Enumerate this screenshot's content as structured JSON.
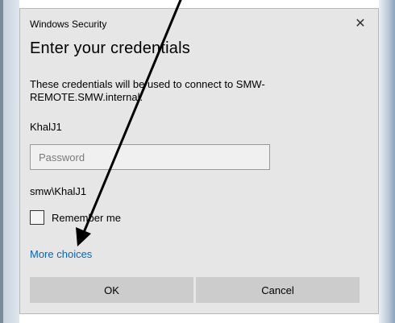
{
  "dialog": {
    "window_title": "Windows Security",
    "close_glyph": "✕",
    "heading": "Enter your credentials",
    "description": "These credentials will be used to connect to SMW-REMOTE.SMW.internal.",
    "username": "KhalJ1",
    "password": {
      "value": "",
      "placeholder": "Password"
    },
    "domain_user": "smw\\KhalJ1",
    "remember_me": {
      "label": "Remember me",
      "checked": false
    },
    "more_choices_label": "More choices",
    "ok_label": "OK",
    "cancel_label": "Cancel"
  },
  "annotation": {
    "icon": "arrow-icon",
    "color": "#000000"
  },
  "colors": {
    "dialog_bg": "#e6e6e6",
    "link": "#0067c0",
    "button_bg": "#cccccc"
  }
}
